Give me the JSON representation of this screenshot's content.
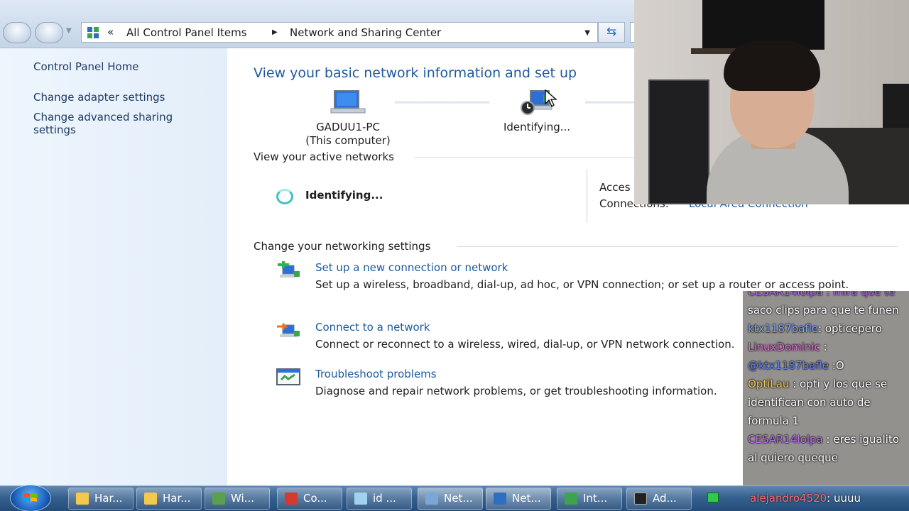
{
  "breadcrumb": {
    "overflow_glyph": "«",
    "items": [
      "All Control Panel Items",
      "Network and Sharing Center"
    ],
    "separator": "▶",
    "dropdown_glyph": "▼",
    "refresh_glyph": "⇆"
  },
  "sidebar": {
    "home": "Control Panel Home",
    "links": [
      "Change adapter settings",
      "Change advanced sharing settings"
    ]
  },
  "main": {
    "title": "View your basic network information and set up",
    "network_map": {
      "computer_name": "GADUU1-PC",
      "computer_note": "(This computer)",
      "network_status": "Identifying..."
    },
    "active_networks": {
      "heading": "View your active networks",
      "status": "Identifying...",
      "access_label": "Acces",
      "connections_label": "Connections:",
      "connection_link": "Local Area Connection"
    },
    "settings": {
      "heading": "Change your networking settings",
      "tasks": [
        {
          "title": "Set up a new connection or network",
          "desc": "Set up a wireless, broadband, dial-up, ad hoc, or VPN connection; or set up a router or access point.",
          "icon": "new-connection-icon"
        },
        {
          "title": "Connect to a network",
          "desc": "Connect or reconnect to a wireless, wired, dial-up, or VPN network connection.",
          "icon": "connect-network-icon"
        },
        {
          "title": "Troubleshoot problems",
          "desc": "Diagnose and repair network problems, or get troubleshooting information.",
          "icon": "troubleshoot-icon"
        }
      ]
    }
  },
  "chat": [
    {
      "user": "",
      "text": "saco clips para que te funen",
      "color": "#ffffff"
    },
    {
      "user": "ktx1187bafle",
      "text": ": opticepero",
      "color": "#7ea7ff"
    },
    {
      "user": "LinuxDominic",
      "text": " :",
      "color": "#e06ad6"
    },
    {
      "user": "@ktx1187bafle",
      "text": " :O",
      "color": "#5a86ff"
    },
    {
      "user": "OptiLau",
      "text": " : opti y los que se identifican con auto de formula 1",
      "color": "#f0c14b"
    },
    {
      "user": "CESAR14lolpa",
      "text": " : eres igualito al quiero queque",
      "color": "#b76cf0"
    }
  ],
  "chat_top_partial": "CESAR14lolpa : mira que te",
  "taskbar": {
    "items": [
      {
        "label": "Har...",
        "icon_color": "#f2c94c",
        "active": false
      },
      {
        "label": "Har...",
        "icon_color": "#f2c94c",
        "active": false
      },
      {
        "label": "Wi...",
        "icon_color": "#5aa04f",
        "active": false
      },
      {
        "label": "Co...",
        "icon_color": "#d23b2e",
        "active": false
      },
      {
        "label": "id ...",
        "icon_color": "#9fd2f0",
        "active": false
      },
      {
        "label": "Net...",
        "icon_color": "#7aa7d8",
        "active": true
      },
      {
        "label": "Net...",
        "icon_color": "#2f6fbf",
        "active": true
      },
      {
        "label": "Int...",
        "icon_color": "#3fa34d",
        "active": false
      },
      {
        "label": "Ad...",
        "icon_color": "#222222",
        "active": false
      }
    ],
    "tray_message_user": "alejandro4520",
    "tray_message_text": ": uuuu"
  }
}
